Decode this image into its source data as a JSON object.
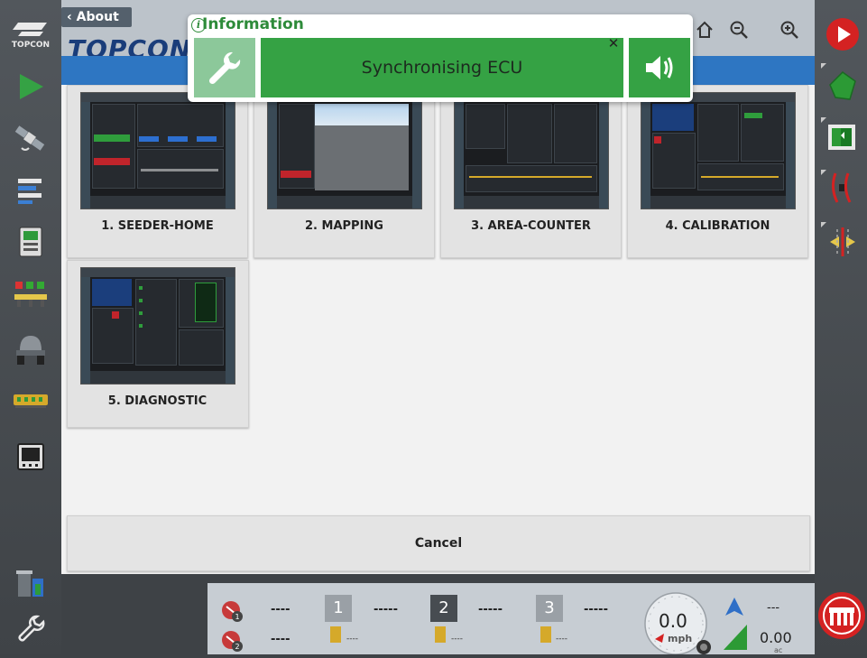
{
  "header": {
    "back_label": "About",
    "banner_text": "TOPCON"
  },
  "left_sidebar": {
    "logo_text": "TOPCON",
    "items": [
      {
        "icon": "topcon-logo-icon"
      },
      {
        "icon": "play-arrow-icon"
      },
      {
        "icon": "satellite-icon"
      },
      {
        "icon": "layers-icon"
      },
      {
        "icon": "console-icon"
      },
      {
        "icon": "section-control-icon"
      },
      {
        "icon": "tractor-icon"
      },
      {
        "icon": "implement-bar-icon"
      },
      {
        "icon": "display-icon"
      },
      {
        "icon": "trash-icon"
      },
      {
        "icon": "wrench-icon"
      }
    ]
  },
  "right_sidebar": {
    "items": [
      {
        "icon": "record-icon",
        "color": "#d42222"
      },
      {
        "icon": "field-boundary-icon",
        "color": "#2c9a35"
      },
      {
        "icon": "headland-icon",
        "color": "#2c9a35"
      },
      {
        "icon": "guidance-lines-icon",
        "color": "#d42222"
      },
      {
        "icon": "shift-line-icon"
      },
      {
        "icon": "implement-brand-icon",
        "color": "#d42222"
      }
    ]
  },
  "info_popup": {
    "title": "Information",
    "message": "Synchronising ECU",
    "colors": {
      "accent": "#35a244",
      "muted": "#8cc89a"
    }
  },
  "screens": [
    {
      "label": "1. SEEDER-HOME"
    },
    {
      "label": "2. MAPPING"
    },
    {
      "label": "3. AREA-COUNTER"
    },
    {
      "label": "4. CALIBRATION"
    },
    {
      "label": "5. DIAGNOSTIC"
    }
  ],
  "cancel_label": "Cancel",
  "status_bar": {
    "rate1": "----",
    "rate2": "----",
    "bins": [
      {
        "number": "1",
        "value": "-----",
        "sub": "----"
      },
      {
        "number": "2",
        "value": "-----",
        "sub": "----"
      },
      {
        "number": "3",
        "value": "-----",
        "sub": "----"
      }
    ],
    "speed": "0.0",
    "speed_unit": "mph",
    "top_value": "---",
    "area": "0.00",
    "area_unit": "ac"
  }
}
